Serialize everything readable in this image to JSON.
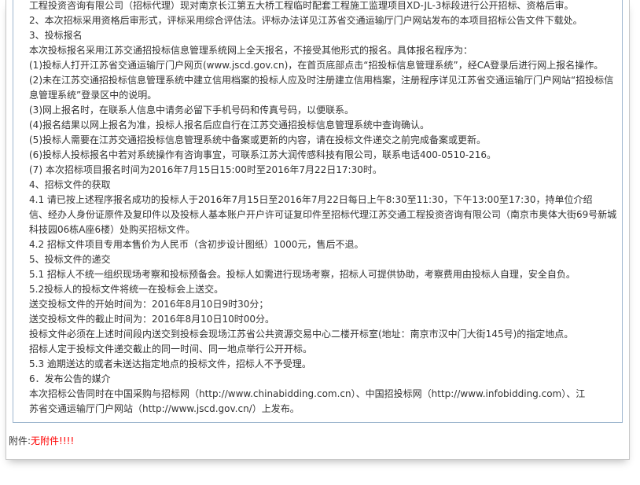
{
  "document": {
    "lines": [
      "工程投资咨询有限公司（招标代理）现对南京长江第五大桥工程临时配套工程施工监理项目XD-JL-3标段进行公开招标、资格后审。",
      "2、本次招标采用资格后审形式，评标采用综合评估法。评标办法详见江苏省交通运输厅门户网站发布的本项目招标公告文件下载处。",
      "3、投标报名",
      "本次投标报名采用江苏交通招投标信息管理系统网上全天报名，不接受其他形式的报名。具体报名程序为：",
      "(1)投标人打开江苏省交通运输厅门户网页(www.jscd.gov.cn)，在首页底部点击“招投标信息管理系统”，经CA登录后进行网上报名操作。",
      "(2)未在江苏交通招投标信息管理系统中建立信用档案的投标人应及时注册建立信用档案，注册程序详见江苏省交通运输厅门户网站“招投标信",
      "息管理系统”登录区中的说明。",
      "(3)网上报名时，在联系人信息中请务必留下手机号码和传真号码，以便联系。",
      "(4)报名结果以网上报名为准，投标人报名后应自行在江苏交通招投标信息管理系统中查询确认。",
      "(5)投标人需要在江苏交通招投标信息管理系统中备案或更新的内容，请在投标文件递交之前完成备案或更新。",
      "(6)投标人投标报名中若对系统操作有咨询事宜，可联系江苏大润传感科技有限公司，联系电话400-0510-216。",
      "(7) 本次招标项目报名时间为2016年7月15日15:00时至2016年7月22日17:30时。",
      "4、招标文件的获取",
      "4.1 请已按上述程序报名成功的投标人于2016年7月15日至2016年7月22日每日上午8:30至11:30，下午13:00至17:30，持单位介绍",
      "信、经办人身份证原件及复印件以及投标人基本账户开户许可证复印件至招标代理江苏交通工程投资咨询有限公司（南京市奥体大街69号新城",
      "科技园06栋A座6楼）处购买招标文件。",
      "4.2 招标文件项目专用本售价为人民币（含初步设计图纸）1000元，售后不退。",
      "5、投标文件的递交",
      "5.1 招标人不统一组织现场考察和投标预备会。投标人如需进行现场考察，招标人可提供协助，考察费用由投标人自理，安全自负。",
      "5.2投标人的投标文件将统一在投标会上送交。",
      "送交投标文件的开始时间为：2016年8月10日9时30分；",
      "送交投标文件的截止时间为：2016年8月10日10时00分。",
      "投标文件必须在上述时间段内送交到投标会现场江苏省公共资源交易中心二楼开标室(地址：南京市汉中门大街145号)的指定地点。",
      "招标人定于投标文件递交截止的同一时间、同一地点举行公开开标。",
      "5.3 逾期送达的或者未送达指定地点的投标文件，招标人不予受理。",
      "6．发布公告的媒介",
      "本次招标公告同时在中国采购与招标网（http://www.chinabidding.com.cn）、中国招投标网（http://www.infobidding.com）、江",
      "苏省交通运输厅门户网站（http://www.jscd.gov.cn/）上发布。"
    ]
  },
  "attachment": {
    "label": "附件:",
    "value": "无附件!!!!"
  }
}
